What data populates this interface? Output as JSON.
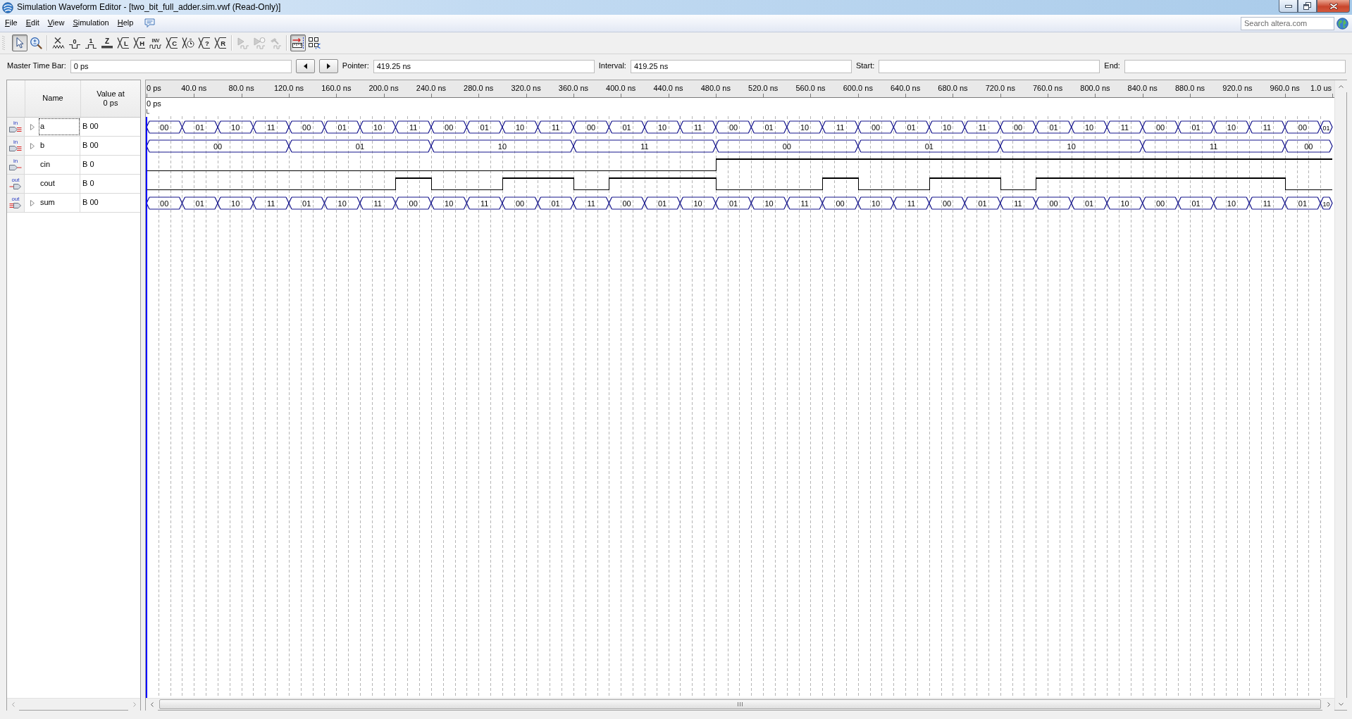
{
  "window": {
    "title": "Simulation Waveform Editor - [two_bit_full_adder.sim.vwf (Read-Only)]"
  },
  "menu": [
    {
      "label": "File"
    },
    {
      "label": "Edit"
    },
    {
      "label": "View"
    },
    {
      "label": "Simulation"
    },
    {
      "label": "Help"
    }
  ],
  "search": {
    "placeholder": "Search altera.com"
  },
  "toolbar": [
    {
      "kind": "select",
      "pressed": true,
      "disabled": false
    },
    {
      "kind": "zoom",
      "pressed": false,
      "disabled": false
    },
    {
      "kind": "separator"
    },
    {
      "kind": "unknown",
      "pressed": false,
      "disabled": false
    },
    {
      "kind": "low",
      "glyph": "0",
      "pressed": false,
      "disabled": false
    },
    {
      "kind": "high",
      "glyph": "1",
      "pressed": false,
      "disabled": false
    },
    {
      "kind": "hiz",
      "glyph": "Z",
      "pressed": false,
      "disabled": false
    },
    {
      "kind": "bus",
      "glyph": "L",
      "pressed": false,
      "disabled": false
    },
    {
      "kind": "bus",
      "glyph": "H",
      "pressed": false,
      "disabled": false
    },
    {
      "kind": "invert",
      "glyph": "INV",
      "pressed": false,
      "disabled": false
    },
    {
      "kind": "bus",
      "glyph": "C",
      "pressed": false,
      "disabled": false
    },
    {
      "kind": "clock",
      "pressed": false,
      "disabled": false
    },
    {
      "kind": "bus",
      "glyph": "?",
      "pressed": false,
      "disabled": false
    },
    {
      "kind": "bus",
      "glyph": "R",
      "pressed": false,
      "disabled": false
    },
    {
      "kind": "separator"
    },
    {
      "kind": "run",
      "pressed": false,
      "disabled": true
    },
    {
      "kind": "run-timing",
      "pressed": false,
      "disabled": true
    },
    {
      "kind": "generate",
      "pressed": false,
      "disabled": true
    },
    {
      "kind": "separator"
    },
    {
      "kind": "snap",
      "pressed": true,
      "disabled": false
    },
    {
      "kind": "grid",
      "pressed": false,
      "disabled": false
    }
  ],
  "time_bar": {
    "master": {
      "label": "Master Time Bar:",
      "value": "0 ps"
    },
    "fields": [
      {
        "label": "Pointer:",
        "value": "419.25 ns"
      },
      {
        "label": "Interval:",
        "value": "419.25 ns"
      },
      {
        "label": "Start:"
      },
      {
        "label": "End:"
      }
    ]
  },
  "signal_list": {
    "columns": [
      "Name",
      "Value at 0 ps"
    ]
  },
  "time_ruler": {
    "ticks": [
      "0 ps",
      "40.0 ns",
      "80.0 ns",
      "120.0 ns",
      "160.0 ns",
      "200.0 ns",
      "240.0 ns",
      "280.0 ns",
      "320.0 ns",
      "360.0 ns",
      "400.0 ns",
      "440.0 ns",
      "480.0 ns",
      "520.0 ns",
      "560.0 ns",
      "600.0 ns",
      "640.0 ns",
      "680.0 ns",
      "720.0 ns",
      "760.0 ns",
      "800.0 ns",
      "840.0 ns",
      "880.0 ns",
      "920.0 ns",
      "960.0 ns",
      "1.0 us"
    ]
  },
  "time_bar_marker": {
    "label": "0 ps"
  },
  "signals": [
    {
      "name": "a",
      "kind": "bus-in",
      "direction": "in",
      "value": "B 00",
      "selected": true,
      "cells": [
        {
          "transition": true,
          "value": "00"
        },
        {
          "transition": false
        },
        {
          "transition": false
        },
        {
          "transition": true,
          "value": "01"
        },
        {
          "transition": false
        },
        {
          "transition": false
        },
        {
          "transition": true,
          "value": "10"
        },
        {
          "transition": false
        },
        {
          "transition": false
        },
        {
          "transition": true,
          "value": "11"
        },
        {
          "transition": false
        },
        {
          "transition": false
        },
        {
          "transition": true,
          "value": "00"
        },
        {
          "transition": false
        },
        {
          "transition": false
        },
        {
          "transition": true,
          "value": "01"
        },
        {
          "transition": false
        },
        {
          "transition": false
        },
        {
          "transition": true,
          "value": "10"
        },
        {
          "transition": false
        },
        {
          "transition": false
        },
        {
          "transition": true,
          "value": "11"
        },
        {
          "transition": false
        },
        {
          "transition": false
        },
        {
          "transition": true,
          "value": "00"
        },
        {
          "transition": false
        },
        {
          "transition": false
        },
        {
          "transition": true,
          "value": "01"
        },
        {
          "transition": false
        },
        {
          "transition": false
        },
        {
          "transition": true,
          "value": "10"
        },
        {
          "transition": false
        },
        {
          "transition": false
        },
        {
          "transition": true,
          "value": "11"
        },
        {
          "transition": false
        },
        {
          "transition": false
        },
        {
          "transition": true,
          "value": "00"
        },
        {
          "transition": false
        },
        {
          "transition": false
        },
        {
          "transition": true,
          "value": "01"
        },
        {
          "transition": false
        },
        {
          "transition": false
        },
        {
          "transition": true,
          "value": "10"
        },
        {
          "transition": false
        },
        {
          "transition": false
        },
        {
          "transition": true,
          "value": "11"
        },
        {
          "transition": false
        },
        {
          "transition": false
        },
        {
          "transition": true,
          "value": "00"
        },
        {
          "transition": false
        },
        {
          "transition": false
        },
        {
          "transition": true,
          "value": "01"
        },
        {
          "transition": false
        },
        {
          "transition": false
        },
        {
          "transition": true,
          "value": "10"
        },
        {
          "transition": false
        },
        {
          "transition": false
        },
        {
          "transition": true,
          "value": "11"
        },
        {
          "transition": false
        },
        {
          "transition": false
        },
        {
          "transition": true,
          "value": "00"
        },
        {
          "transition": false
        },
        {
          "transition": false
        },
        {
          "transition": true,
          "value": "01"
        },
        {
          "transition": false
        },
        {
          "transition": false
        },
        {
          "transition": true,
          "value": "10"
        },
        {
          "transition": false
        },
        {
          "transition": false
        },
        {
          "transition": true,
          "value": "11"
        },
        {
          "transition": false
        },
        {
          "transition": false
        },
        {
          "transition": true,
          "value": "00"
        },
        {
          "transition": false
        },
        {
          "transition": false
        },
        {
          "transition": true,
          "value": "01"
        },
        {
          "transition": false
        },
        {
          "transition": false
        },
        {
          "transition": true,
          "value": "10"
        },
        {
          "transition": false
        },
        {
          "transition": false
        },
        {
          "transition": true,
          "value": "11"
        },
        {
          "transition": false
        },
        {
          "transition": false
        },
        {
          "transition": true,
          "value": "00"
        },
        {
          "transition": false
        },
        {
          "transition": false
        },
        {
          "transition": true,
          "value": "01"
        },
        {
          "transition": false
        },
        {
          "transition": false
        },
        {
          "transition": true,
          "value": "10"
        },
        {
          "transition": false
        },
        {
          "transition": false
        },
        {
          "transition": true,
          "value": "11"
        },
        {
          "transition": false
        },
        {
          "transition": false
        },
        {
          "transition": true,
          "value": "00"
        },
        {
          "transition": false
        },
        {
          "transition": false
        },
        {
          "transition": true,
          "value": "01"
        }
      ]
    },
    {
      "name": "b",
      "kind": "bus-in",
      "direction": "in",
      "value": "B 00",
      "selected": false,
      "cells": [
        {
          "transition": true,
          "value": "00"
        },
        {
          "transition": false
        },
        {
          "transition": false
        },
        {
          "transition": false
        },
        {
          "transition": false
        },
        {
          "transition": false
        },
        {
          "transition": false
        },
        {
          "transition": false
        },
        {
          "transition": false
        },
        {
          "transition": false
        },
        {
          "transition": false
        },
        {
          "transition": false
        },
        {
          "transition": true,
          "value": "01"
        },
        {
          "transition": false
        },
        {
          "transition": false
        },
        {
          "transition": false
        },
        {
          "transition": false
        },
        {
          "transition": false
        },
        {
          "transition": false
        },
        {
          "transition": false
        },
        {
          "transition": false
        },
        {
          "transition": false
        },
        {
          "transition": false
        },
        {
          "transition": false
        },
        {
          "transition": true,
          "value": "10"
        },
        {
          "transition": false
        },
        {
          "transition": false
        },
        {
          "transition": false
        },
        {
          "transition": false
        },
        {
          "transition": false
        },
        {
          "transition": false
        },
        {
          "transition": false
        },
        {
          "transition": false
        },
        {
          "transition": false
        },
        {
          "transition": false
        },
        {
          "transition": false
        },
        {
          "transition": true,
          "value": "11"
        },
        {
          "transition": false
        },
        {
          "transition": false
        },
        {
          "transition": false
        },
        {
          "transition": false
        },
        {
          "transition": false
        },
        {
          "transition": false
        },
        {
          "transition": false
        },
        {
          "transition": false
        },
        {
          "transition": false
        },
        {
          "transition": false
        },
        {
          "transition": false
        },
        {
          "transition": true,
          "value": "00"
        },
        {
          "transition": false
        },
        {
          "transition": false
        },
        {
          "transition": false
        },
        {
          "transition": false
        },
        {
          "transition": false
        },
        {
          "transition": false
        },
        {
          "transition": false
        },
        {
          "transition": false
        },
        {
          "transition": false
        },
        {
          "transition": false
        },
        {
          "transition": false
        },
        {
          "transition": true,
          "value": "01"
        },
        {
          "transition": false
        },
        {
          "transition": false
        },
        {
          "transition": false
        },
        {
          "transition": false
        },
        {
          "transition": false
        },
        {
          "transition": false
        },
        {
          "transition": false
        },
        {
          "transition": false
        },
        {
          "transition": false
        },
        {
          "transition": false
        },
        {
          "transition": false
        },
        {
          "transition": true,
          "value": "10"
        },
        {
          "transition": false
        },
        {
          "transition": false
        },
        {
          "transition": false
        },
        {
          "transition": false
        },
        {
          "transition": false
        },
        {
          "transition": false
        },
        {
          "transition": false
        },
        {
          "transition": false
        },
        {
          "transition": false
        },
        {
          "transition": false
        },
        {
          "transition": false
        },
        {
          "transition": true,
          "value": "11"
        },
        {
          "transition": false
        },
        {
          "transition": false
        },
        {
          "transition": false
        },
        {
          "transition": false
        },
        {
          "transition": false
        },
        {
          "transition": false
        },
        {
          "transition": false
        },
        {
          "transition": false
        },
        {
          "transition": false
        },
        {
          "transition": false
        },
        {
          "transition": false
        },
        {
          "transition": true,
          "value": "00"
        },
        {
          "transition": false
        },
        {
          "transition": false
        },
        {
          "transition": false
        }
      ]
    },
    {
      "name": "cin",
      "kind": "bit-in",
      "direction": "in",
      "value": "B 0",
      "selected": false,
      "cells": [
        {
          "high": false
        },
        {
          "high": false
        },
        {
          "high": false
        },
        {
          "high": false
        },
        {
          "high": false
        },
        {
          "high": false
        },
        {
          "high": false
        },
        {
          "high": false
        },
        {
          "high": false
        },
        {
          "high": false
        },
        {
          "high": false
        },
        {
          "high": false
        },
        {
          "high": false
        },
        {
          "high": false
        },
        {
          "high": false
        },
        {
          "high": false
        },
        {
          "high": false
        },
        {
          "high": false
        },
        {
          "high": false
        },
        {
          "high": false
        },
        {
          "high": false
        },
        {
          "high": false
        },
        {
          "high": false
        },
        {
          "high": false
        },
        {
          "high": false
        },
        {
          "high": false
        },
        {
          "high": false
        },
        {
          "high": false
        },
        {
          "high": false
        },
        {
          "high": false
        },
        {
          "high": false
        },
        {
          "high": false
        },
        {
          "high": false
        },
        {
          "high": false
        },
        {
          "high": false
        },
        {
          "high": false
        },
        {
          "high": false
        },
        {
          "high": false
        },
        {
          "high": false
        },
        {
          "high": false
        },
        {
          "high": false
        },
        {
          "high": false
        },
        {
          "high": false
        },
        {
          "high": false
        },
        {
          "high": false
        },
        {
          "high": false
        },
        {
          "high": false
        },
        {
          "high": false
        },
        {
          "high": true
        },
        {
          "high": true
        },
        {
          "high": true
        },
        {
          "high": true
        },
        {
          "high": true
        },
        {
          "high": true
        },
        {
          "high": true
        },
        {
          "high": true
        },
        {
          "high": true
        },
        {
          "high": true
        },
        {
          "high": true
        },
        {
          "high": true
        },
        {
          "high": true
        },
        {
          "high": true
        },
        {
          "high": true
        },
        {
          "high": true
        },
        {
          "high": true
        },
        {
          "high": true
        },
        {
          "high": true
        },
        {
          "high": true
        },
        {
          "high": true
        },
        {
          "high": true
        },
        {
          "high": true
        },
        {
          "high": true
        },
        {
          "high": true
        },
        {
          "high": true
        },
        {
          "high": true
        },
        {
          "high": true
        },
        {
          "high": true
        },
        {
          "high": true
        },
        {
          "high": true
        },
        {
          "high": true
        },
        {
          "high": true
        },
        {
          "high": true
        },
        {
          "high": true
        },
        {
          "high": true
        },
        {
          "high": true
        },
        {
          "high": true
        },
        {
          "high": true
        },
        {
          "high": true
        },
        {
          "high": true
        },
        {
          "high": true
        },
        {
          "high": true
        },
        {
          "high": true
        },
        {
          "high": true
        },
        {
          "high": true
        },
        {
          "high": true
        },
        {
          "high": true
        },
        {
          "high": true
        },
        {
          "high": true
        },
        {
          "high": true
        },
        {
          "high": true
        }
      ]
    },
    {
      "name": "cout",
      "kind": "bit-out",
      "direction": "out",
      "value": "B 0",
      "selected": false,
      "cells": [
        {
          "high": false
        },
        {
          "high": false
        },
        {
          "high": false
        },
        {
          "high": false
        },
        {
          "high": false
        },
        {
          "high": false
        },
        {
          "high": false
        },
        {
          "high": false
        },
        {
          "high": false
        },
        {
          "high": false
        },
        {
          "high": false
        },
        {
          "high": false
        },
        {
          "high": false
        },
        {
          "high": false
        },
        {
          "high": false
        },
        {
          "high": false
        },
        {
          "high": false
        },
        {
          "high": false
        },
        {
          "high": false
        },
        {
          "high": false
        },
        {
          "high": false
        },
        {
          "high": true
        },
        {
          "high": true
        },
        {
          "high": true
        },
        {
          "high": false
        },
        {
          "high": false
        },
        {
          "high": false
        },
        {
          "high": false
        },
        {
          "high": false
        },
        {
          "high": false
        },
        {
          "high": true
        },
        {
          "high": true
        },
        {
          "high": true
        },
        {
          "high": true
        },
        {
          "high": true
        },
        {
          "high": true
        },
        {
          "high": false
        },
        {
          "high": false
        },
        {
          "high": false
        },
        {
          "high": true
        },
        {
          "high": true
        },
        {
          "high": true
        },
        {
          "high": true
        },
        {
          "high": true
        },
        {
          "high": true
        },
        {
          "high": true
        },
        {
          "high": true
        },
        {
          "high": true
        },
        {
          "high": false
        },
        {
          "high": false
        },
        {
          "high": false
        },
        {
          "high": false
        },
        {
          "high": false
        },
        {
          "high": false
        },
        {
          "high": false
        },
        {
          "high": false
        },
        {
          "high": false
        },
        {
          "high": true
        },
        {
          "high": true
        },
        {
          "high": true
        },
        {
          "high": false
        },
        {
          "high": false
        },
        {
          "high": false
        },
        {
          "high": false
        },
        {
          "high": false
        },
        {
          "high": false
        },
        {
          "high": true
        },
        {
          "high": true
        },
        {
          "high": true
        },
        {
          "high": true
        },
        {
          "high": true
        },
        {
          "high": true
        },
        {
          "high": false
        },
        {
          "high": false
        },
        {
          "high": false
        },
        {
          "high": true
        },
        {
          "high": true
        },
        {
          "high": true
        },
        {
          "high": true
        },
        {
          "high": true
        },
        {
          "high": true
        },
        {
          "high": true
        },
        {
          "high": true
        },
        {
          "high": true
        },
        {
          "high": true
        },
        {
          "high": true
        },
        {
          "high": true
        },
        {
          "high": true
        },
        {
          "high": true
        },
        {
          "high": true
        },
        {
          "high": true
        },
        {
          "high": true
        },
        {
          "high": true
        },
        {
          "high": true
        },
        {
          "high": true
        },
        {
          "high": true
        },
        {
          "high": false
        },
        {
          "high": false
        },
        {
          "high": false
        },
        {
          "high": false
        }
      ]
    },
    {
      "name": "sum",
      "kind": "bus-out",
      "direction": "out",
      "value": "B 00",
      "selected": false,
      "cells": [
        {
          "transition": true,
          "value": "00"
        },
        {
          "transition": false
        },
        {
          "transition": false
        },
        {
          "transition": true,
          "value": "01"
        },
        {
          "transition": false
        },
        {
          "transition": false
        },
        {
          "transition": true,
          "value": "10"
        },
        {
          "transition": false
        },
        {
          "transition": false
        },
        {
          "transition": true,
          "value": "11"
        },
        {
          "transition": false
        },
        {
          "transition": false
        },
        {
          "transition": true,
          "value": "01"
        },
        {
          "transition": false
        },
        {
          "transition": false
        },
        {
          "transition": true,
          "value": "10"
        },
        {
          "transition": false
        },
        {
          "transition": false
        },
        {
          "transition": true,
          "value": "11"
        },
        {
          "transition": false
        },
        {
          "transition": false
        },
        {
          "transition": true,
          "value": "00"
        },
        {
          "transition": false
        },
        {
          "transition": false
        },
        {
          "transition": true,
          "value": "10"
        },
        {
          "transition": false
        },
        {
          "transition": false
        },
        {
          "transition": true,
          "value": "11"
        },
        {
          "transition": false
        },
        {
          "transition": false
        },
        {
          "transition": true,
          "value": "00"
        },
        {
          "transition": false
        },
        {
          "transition": false
        },
        {
          "transition": true,
          "value": "01"
        },
        {
          "transition": false
        },
        {
          "transition": false
        },
        {
          "transition": true,
          "value": "11"
        },
        {
          "transition": false
        },
        {
          "transition": false
        },
        {
          "transition": true,
          "value": "00"
        },
        {
          "transition": false
        },
        {
          "transition": false
        },
        {
          "transition": true,
          "value": "01"
        },
        {
          "transition": false
        },
        {
          "transition": false
        },
        {
          "transition": true,
          "value": "10"
        },
        {
          "transition": false
        },
        {
          "transition": false
        },
        {
          "transition": true,
          "value": "01"
        },
        {
          "transition": false
        },
        {
          "transition": false
        },
        {
          "transition": true,
          "value": "10"
        },
        {
          "transition": false
        },
        {
          "transition": false
        },
        {
          "transition": true,
          "value": "11"
        },
        {
          "transition": false
        },
        {
          "transition": false
        },
        {
          "transition": true,
          "value": "00"
        },
        {
          "transition": false
        },
        {
          "transition": false
        },
        {
          "transition": true,
          "value": "10"
        },
        {
          "transition": false
        },
        {
          "transition": false
        },
        {
          "transition": true,
          "value": "11"
        },
        {
          "transition": false
        },
        {
          "transition": false
        },
        {
          "transition": true,
          "value": "00"
        },
        {
          "transition": false
        },
        {
          "transition": false
        },
        {
          "transition": true,
          "value": "01"
        },
        {
          "transition": false
        },
        {
          "transition": false
        },
        {
          "transition": true,
          "value": "11"
        },
        {
          "transition": false
        },
        {
          "transition": false
        },
        {
          "transition": true,
          "value": "00"
        },
        {
          "transition": false
        },
        {
          "transition": false
        },
        {
          "transition": true,
          "value": "01"
        },
        {
          "transition": false
        },
        {
          "transition": false
        },
        {
          "transition": true,
          "value": "10"
        },
        {
          "transition": false
        },
        {
          "transition": false
        },
        {
          "transition": true,
          "value": "00"
        },
        {
          "transition": false
        },
        {
          "transition": false
        },
        {
          "transition": true,
          "value": "01"
        },
        {
          "transition": false
        },
        {
          "transition": false
        },
        {
          "transition": true,
          "value": "10"
        },
        {
          "transition": false
        },
        {
          "transition": false
        },
        {
          "transition": true,
          "value": "11"
        },
        {
          "transition": false
        },
        {
          "transition": false
        },
        {
          "transition": true,
          "value": "01"
        },
        {
          "transition": false
        },
        {
          "transition": false
        },
        {
          "transition": true,
          "value": "10"
        }
      ]
    }
  ]
}
